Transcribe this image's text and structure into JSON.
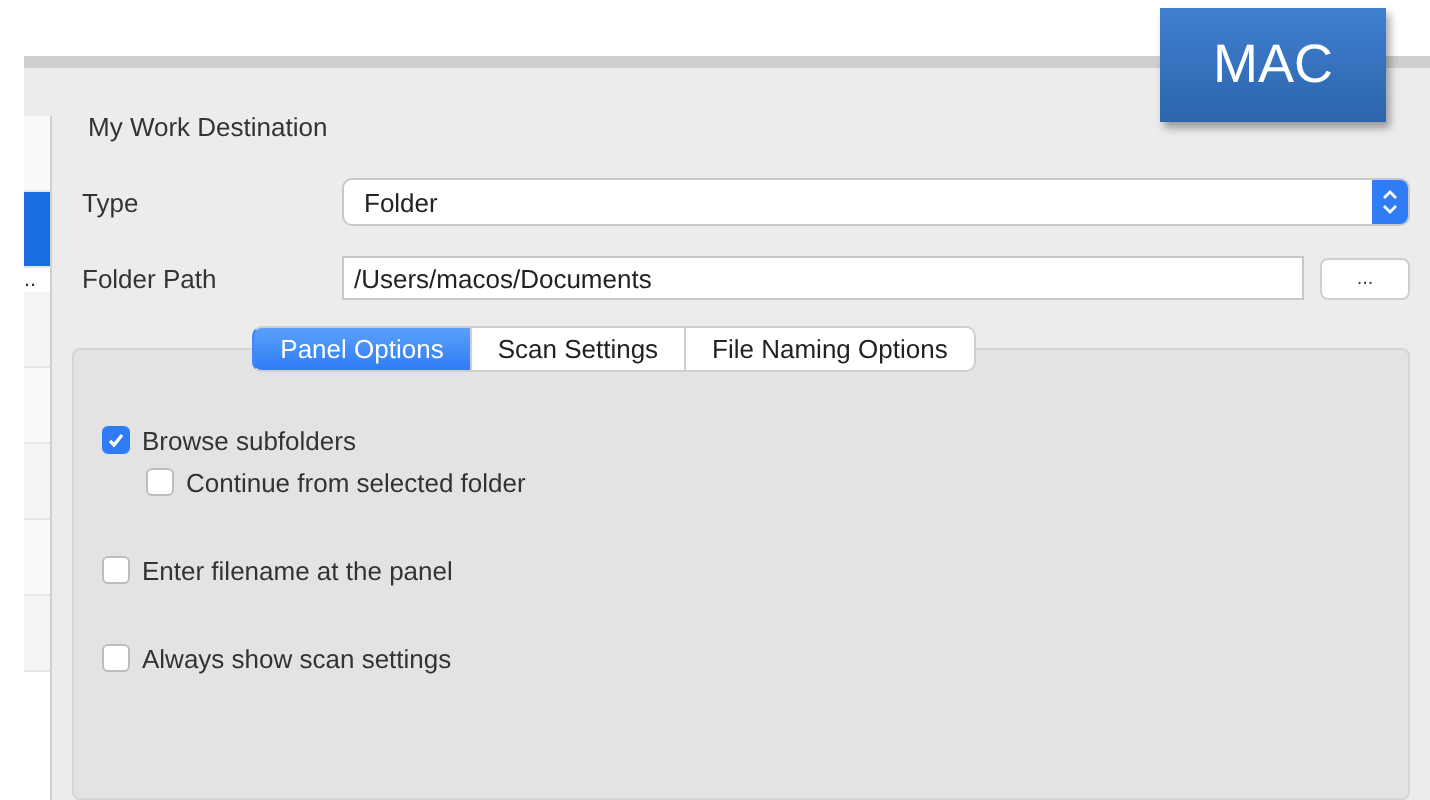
{
  "badge": "MAC",
  "sidebar": {
    "more": "..",
    "rows": [
      {
        "selected": false
      },
      {
        "selected": true
      },
      {
        "selected": false
      },
      {
        "selected": false
      },
      {
        "selected": false
      },
      {
        "selected": false
      },
      {
        "selected": false
      }
    ]
  },
  "section_title": "My Work Destination",
  "type": {
    "label": "Type",
    "value": "Folder"
  },
  "folder_path": {
    "label": "Folder Path",
    "value": "/Users/macos/Documents",
    "browse": "..."
  },
  "tabs": [
    {
      "label": "Panel Options",
      "selected": true
    },
    {
      "label": "Scan Settings",
      "selected": false
    },
    {
      "label": "File Naming Options",
      "selected": false
    }
  ],
  "options": [
    {
      "label": "Browse subfolders",
      "checked": true,
      "children": [
        {
          "label": "Continue from selected folder",
          "checked": false
        }
      ]
    },
    {
      "label": "Enter filename at the panel",
      "checked": false
    },
    {
      "label": "Always show scan settings",
      "checked": false
    }
  ]
}
